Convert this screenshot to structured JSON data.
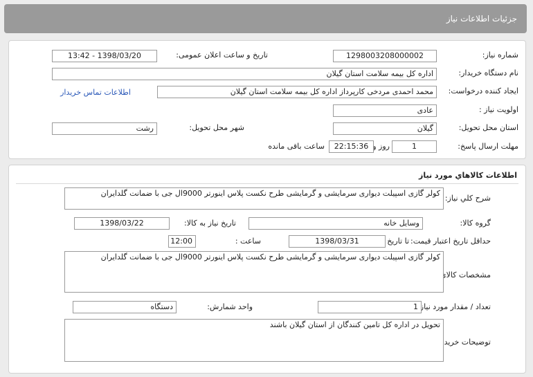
{
  "header": {
    "title": "جزئیات اطلاعات نیاز"
  },
  "info": {
    "need_number_label": "شماره نیاز:",
    "need_number": "1298003208000002",
    "announce_label": "تاریخ و ساعت اعلان عمومی:",
    "announce_value": "1398/03/20 - 13:42",
    "buyer_org_label": "نام دستگاه خریدار:",
    "buyer_org": "اداره کل بیمه سلامت استان گیلان",
    "requester_label": "ایجاد کننده درخواست:",
    "requester": "محمد احمدی مردخی کارپرداز اداره کل بیمه سلامت استان گیلان",
    "contact_link": "اطلاعات تماس خریدار",
    "priority_label": "اولویت نیاز :",
    "priority": "عادی",
    "province_label": "استان محل تحویل:",
    "province": "گیلان",
    "city_label": "شهر محل تحویل:",
    "city": "رشت",
    "deadline_label": "مهلت ارسال پاسخ:",
    "days": "1",
    "days_label": "روز و",
    "time_left": "22:15:36",
    "time_left_label": "ساعت باقی مانده"
  },
  "goods": {
    "section_title": "اطلاعات کالاهاي مورد نياز",
    "desc_label": "شرح کلي نياز:",
    "desc": "کولر گازی اسپیلت  دیواری سرمایشی و گرمایشی طرح نکست پلاس اینورتر 9000ال جی با ضمانت گلدایران",
    "group_label": "گروه کالا:",
    "group": "وسایل خانه",
    "need_date_label": "تاریخ نیاز به کالا:",
    "need_date": "1398/03/22",
    "validity_label": "حداقل تاریخ اعتبار قیمت:",
    "validity_until_label": "تا تاریخ :",
    "validity_date": "1398/03/31",
    "validity_time_label": "ساعت :",
    "validity_time": "12:00",
    "spec_label": "مشخصات کالاي مورد نياز:",
    "spec": "کولر گازی اسپیلت  دیواری سرمایشی و گرمایشی طرح نکست پلاس اینورتر 9000ال جی با ضمانت گلدایران",
    "qty_label": "تعداد / مقدار مورد نیاز:",
    "qty": "1",
    "unit_label": "واحد شمارش:",
    "unit": "دستگاه",
    "notes_label": "توضیحات خریدار:",
    "notes": "تحویل در اداره کل تامین کنندگان از استان گیلان باشند"
  }
}
